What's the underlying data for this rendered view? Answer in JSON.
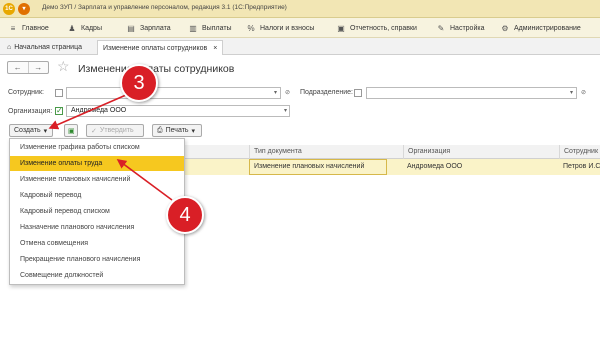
{
  "window": {
    "title": "Демо ЗУП / Зарплата и управление персоналом, редакция 3.1 (1С:Предприятие)",
    "logo": "1С",
    "accent": "#f0a000"
  },
  "menu": [
    {
      "label": "Главное",
      "icon": "menu-lines-icon"
    },
    {
      "label": "Кадры",
      "icon": "person-icon"
    },
    {
      "label": "Зарплата",
      "icon": "document-icon"
    },
    {
      "label": "Выплаты",
      "icon": "money-icon"
    },
    {
      "label": "Налоги и взносы",
      "icon": "percent-icon"
    },
    {
      "label": "Отчетность, справки",
      "icon": "report-icon"
    },
    {
      "label": "Настройка",
      "icon": "wrench-icon"
    },
    {
      "label": "Администрирование",
      "icon": "gear-icon"
    }
  ],
  "tabs": {
    "home": "Начальная страница",
    "current": "Изменение оплаты сотрудников"
  },
  "page": {
    "title": "Изменение оплаты сотрудников"
  },
  "filters": {
    "employee_label": "Сотрудник:",
    "department_label": "Подразделение:",
    "org_label": "Организация:",
    "org_value": "Андромеда ООО"
  },
  "toolbar": {
    "create": "Создать",
    "approve": "Утвердить",
    "print": "Печать"
  },
  "table": {
    "columns": [
      "Тип документа",
      "Организация",
      "Сотрудник"
    ],
    "rows": [
      [
        "Изменение плановых начислений",
        "Андромеда ООО",
        "Петров И.С."
      ]
    ]
  },
  "dropdown": {
    "items": [
      "Изменение графика работы списком",
      "Изменение оплаты труда",
      "Изменение плановых начислений",
      "Кадровый перевод",
      "Кадровый перевод списком",
      "Назначение планового начисления",
      "Отмена совмещения",
      "Прекращение планового начисления",
      "Совмещение должностей"
    ],
    "highlighted_index": 1
  },
  "markers": [
    "3",
    "4"
  ],
  "colors": {
    "marker": "#d91f26",
    "highlight": "#f6c81f",
    "selected_row": "#faf3c8"
  }
}
